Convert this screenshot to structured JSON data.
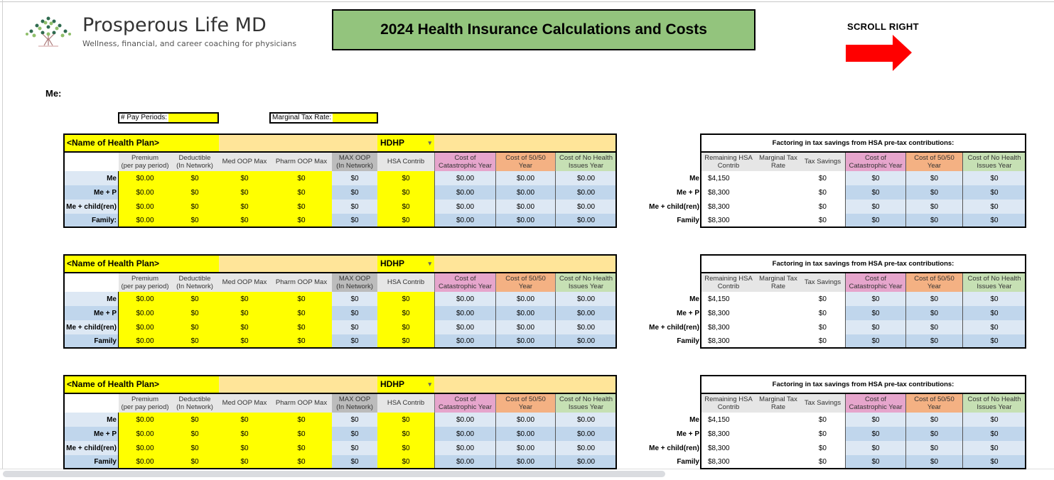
{
  "logo": {
    "title": "Prosperous Life MD",
    "subtitle": "Wellness, financial, and career coaching for physicians"
  },
  "page_title": "2024 Health Insurance Calculations and Costs",
  "scroll_hint": "SCROLL RIGHT",
  "section_label": "Me:",
  "inputs": {
    "pay_periods_label": "# Pay Periods:",
    "pay_periods_value": "",
    "tax_rate_label": "Marginal Tax Rate:",
    "tax_rate_value": ""
  },
  "colors": {
    "yellow": "#ffff00",
    "plan_band": "#ffe599",
    "catastrophic": "#e6a5cc",
    "fifty": "#f4b183",
    "no_issues": "#c6e0b4",
    "row_light": "#dde8f4",
    "row_dark": "#c0d6ec",
    "title_green": "#93c47d",
    "arrow": "#ff0000"
  },
  "left_headers": [
    "Premium\n(per pay period)",
    "Deductible\n(In Network)",
    "Med OOP Max",
    "Pharm OOP Max",
    "MAX OOP\n(In Network)",
    "HSA Contrib",
    "Cost of\nCatastrophic Year",
    "Cost of 50/50\nYear",
    "Cost of No Health\nIssues Year"
  ],
  "right_title": "Factoring in tax savings from HSA pre-tax contributions:",
  "right_headers": [
    "Remaining HSA\nContrib",
    "Marginal Tax\nRate",
    "Tax Savings",
    "Cost of\nCatastrophic Year",
    "Cost of 50/50\nYear",
    "Cost of No Health\nIssues Year"
  ],
  "plans": [
    {
      "name": "<Name of Health Plan>",
      "type": "HDHP",
      "rows": [
        {
          "label": "Me",
          "values": [
            "$0.00",
            "$0",
            "$0",
            "$0",
            "$0",
            "$0",
            "$0.00",
            "$0.00",
            "$0.00"
          ]
        },
        {
          "label": "Me + P",
          "values": [
            "$0.00",
            "$0",
            "$0",
            "$0",
            "$0",
            "$0",
            "$0.00",
            "$0.00",
            "$0.00"
          ]
        },
        {
          "label": "Me + child(ren)",
          "values": [
            "$0.00",
            "$0",
            "$0",
            "$0",
            "$0",
            "$0",
            "$0.00",
            "$0.00",
            "$0.00"
          ]
        },
        {
          "label": "Family:",
          "values": [
            "$0.00",
            "$0",
            "$0",
            "$0",
            "$0",
            "$0",
            "$0.00",
            "$0.00",
            "$0.00"
          ]
        }
      ],
      "tax_rows": [
        {
          "label": "Me",
          "values": [
            "$4,150",
            "",
            "$0",
            "$0",
            "$0",
            "$0"
          ]
        },
        {
          "label": "Me + P",
          "values": [
            "$8,300",
            "",
            "$0",
            "$0",
            "$0",
            "$0"
          ]
        },
        {
          "label": "Me + child(ren)",
          "values": [
            "$8,300",
            "",
            "$0",
            "$0",
            "$0",
            "$0"
          ]
        },
        {
          "label": "Family",
          "values": [
            "$8,300",
            "",
            "$0",
            "$0",
            "$0",
            "$0"
          ]
        }
      ]
    },
    {
      "name": "<Name of Health Plan>",
      "type": "HDHP",
      "rows": [
        {
          "label": "Me",
          "values": [
            "$0.00",
            "$0",
            "$0",
            "$0",
            "$0",
            "$0",
            "$0.00",
            "$0.00",
            "$0.00"
          ]
        },
        {
          "label": "Me + P",
          "values": [
            "$0.00",
            "$0",
            "$0",
            "$0",
            "$0",
            "$0",
            "$0.00",
            "$0.00",
            "$0.00"
          ]
        },
        {
          "label": "Me + child(ren)",
          "values": [
            "$0.00",
            "$0",
            "$0",
            "$0",
            "$0",
            "$0",
            "$0.00",
            "$0.00",
            "$0.00"
          ]
        },
        {
          "label": "Family",
          "values": [
            "$0.00",
            "$0",
            "$0",
            "$0",
            "$0",
            "$0",
            "$0.00",
            "$0.00",
            "$0.00"
          ]
        }
      ],
      "tax_rows": [
        {
          "label": "Me",
          "values": [
            "$4,150",
            "",
            "$0",
            "$0",
            "$0",
            "$0"
          ]
        },
        {
          "label": "Me + P",
          "values": [
            "$8,300",
            "",
            "$0",
            "$0",
            "$0",
            "$0"
          ]
        },
        {
          "label": "Me + child(ren)",
          "values": [
            "$8,300",
            "",
            "$0",
            "$0",
            "$0",
            "$0"
          ]
        },
        {
          "label": "Family",
          "values": [
            "$8,300",
            "",
            "$0",
            "$0",
            "$0",
            "$0"
          ]
        }
      ]
    },
    {
      "name": "<Name of Health Plan>",
      "type": "HDHP",
      "rows": [
        {
          "label": "Me",
          "values": [
            "$0.00",
            "$0",
            "$0",
            "$0",
            "$0",
            "$0",
            "$0.00",
            "$0.00",
            "$0.00"
          ]
        },
        {
          "label": "Me + P",
          "values": [
            "$0.00",
            "$0",
            "$0",
            "$0",
            "$0",
            "$0",
            "$0.00",
            "$0.00",
            "$0.00"
          ]
        },
        {
          "label": "Me + child(ren)",
          "values": [
            "$0.00",
            "$0",
            "$0",
            "$0",
            "$0",
            "$0",
            "$0.00",
            "$0.00",
            "$0.00"
          ]
        },
        {
          "label": "Family",
          "values": [
            "$0.00",
            "$0",
            "$0",
            "$0",
            "$0",
            "$0",
            "$0.00",
            "$0.00",
            "$0.00"
          ]
        }
      ],
      "tax_rows": [
        {
          "label": "Me",
          "values": [
            "$4,150",
            "",
            "$0",
            "$0",
            "$0",
            "$0"
          ]
        },
        {
          "label": "Me + P",
          "values": [
            "$8,300",
            "",
            "$0",
            "$0",
            "$0",
            "$0"
          ]
        },
        {
          "label": "Me + child(ren)",
          "values": [
            "$8,300",
            "",
            "$0",
            "$0",
            "$0",
            "$0"
          ]
        },
        {
          "label": "Family",
          "values": [
            "$8,300",
            "",
            "$0",
            "$0",
            "$0",
            "$0"
          ]
        }
      ]
    }
  ]
}
